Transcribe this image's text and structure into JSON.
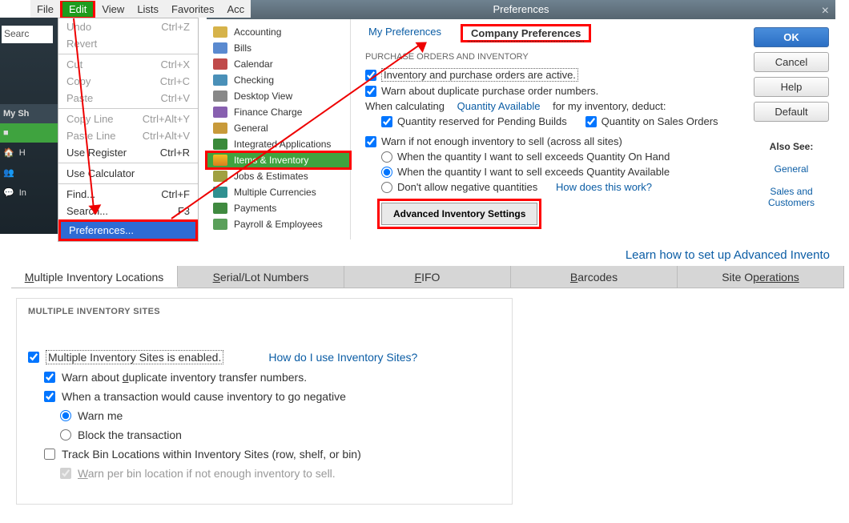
{
  "menubar": {
    "file": "File",
    "edit": "Edit",
    "view": "View",
    "lists": "Lists",
    "favorites": "Favorites",
    "acc": "Acc"
  },
  "back": {
    "search": "Searc",
    "my_sh": "My Sh",
    "h": "H",
    "p_txt": "",
    "in_txt": "In"
  },
  "edit_menu": {
    "undo": {
      "l": "Undo",
      "s": "Ctrl+Z"
    },
    "revert": {
      "l": "Revert",
      "s": ""
    },
    "cut": {
      "l": "Cut",
      "s": "Ctrl+X"
    },
    "copy": {
      "l": "Copy",
      "s": "Ctrl+C"
    },
    "paste": {
      "l": "Paste",
      "s": "Ctrl+V"
    },
    "copy_line": {
      "l": "Copy Line",
      "s": "Ctrl+Alt+Y"
    },
    "paste_line": {
      "l": "Paste Line",
      "s": "Ctrl+Alt+V"
    },
    "use_reg": {
      "l": "Use Register",
      "s": "Ctrl+R"
    },
    "use_calc": {
      "l": "Use Calculator",
      "s": ""
    },
    "find": {
      "l": "Find...",
      "s": "Ctrl+F"
    },
    "search": {
      "l": "Search...",
      "s": "F3"
    },
    "prefs": {
      "l": "Preferences...",
      "s": ""
    }
  },
  "pref": {
    "title": "Preferences",
    "cats": [
      "Accounting",
      "Bills",
      "Calendar",
      "Checking",
      "Desktop View",
      "Finance Charge",
      "General",
      "Integrated Applications",
      "Items & Inventory",
      "Jobs & Estimates",
      "Multiple Currencies",
      "Payments",
      "Payroll & Employees"
    ],
    "tab_my": "My Preferences",
    "tab_comp": "Company Preferences",
    "sect": "PURCHASE ORDERS AND INVENTORY",
    "c1": "Inventory and purchase orders are active.",
    "c2": "Warn about duplicate purchase order numbers.",
    "calc_pre": "When calculating",
    "calc_link": "Quantity Available",
    "calc_post": "for my inventory, deduct:",
    "c3": "Quantity reserved for Pending Builds",
    "c4": "Quantity on Sales Orders",
    "c5": "Warn if not enough inventory to sell (across all sites)",
    "r1": "When the quantity I want to sell exceeds Quantity On Hand",
    "r2": "When the quantity I want to sell exceeds Quantity Available",
    "r3": "Don't allow negative quantities",
    "how": "How does this work?",
    "adv": "Advanced Inventory Settings",
    "btn_ok": "OK",
    "btn_cancel": "Cancel",
    "btn_help": "Help",
    "btn_default": "Default",
    "also": "Also See:",
    "also1": "General",
    "also2": "Sales and Customers"
  },
  "learn": "Learn how to set up Advanced Invento",
  "btabs": {
    "t1": "ultiple Inventory Locations",
    "t1p": "M",
    "t2": "erial/Lot Numbers",
    "t2p": "S",
    "t3": "IFO",
    "t3p": "F",
    "t4": "arcodes",
    "t4p": "B",
    "t5": "perations",
    "t5p": "Site O"
  },
  "panel": {
    "title": "MULTIPLE INVENTORY SITES",
    "c1": "Multiple Inventory Sites is enabled.",
    "link": "How do I use Inventory Sites?",
    "c2_pre": "Warn about ",
    "c2_u": "d",
    "c2_post": "uplicate inventory transfer numbers.",
    "c3": "When a transaction would cause inventory to go negative",
    "r1": "Warn me",
    "r2": "Block the transaction",
    "c4": "Track Bin Locations within Inventory Sites (row, shelf, or bin)",
    "c5_pre": "W",
    "c5_post": "arn per bin location if not enough inventory to sell."
  }
}
